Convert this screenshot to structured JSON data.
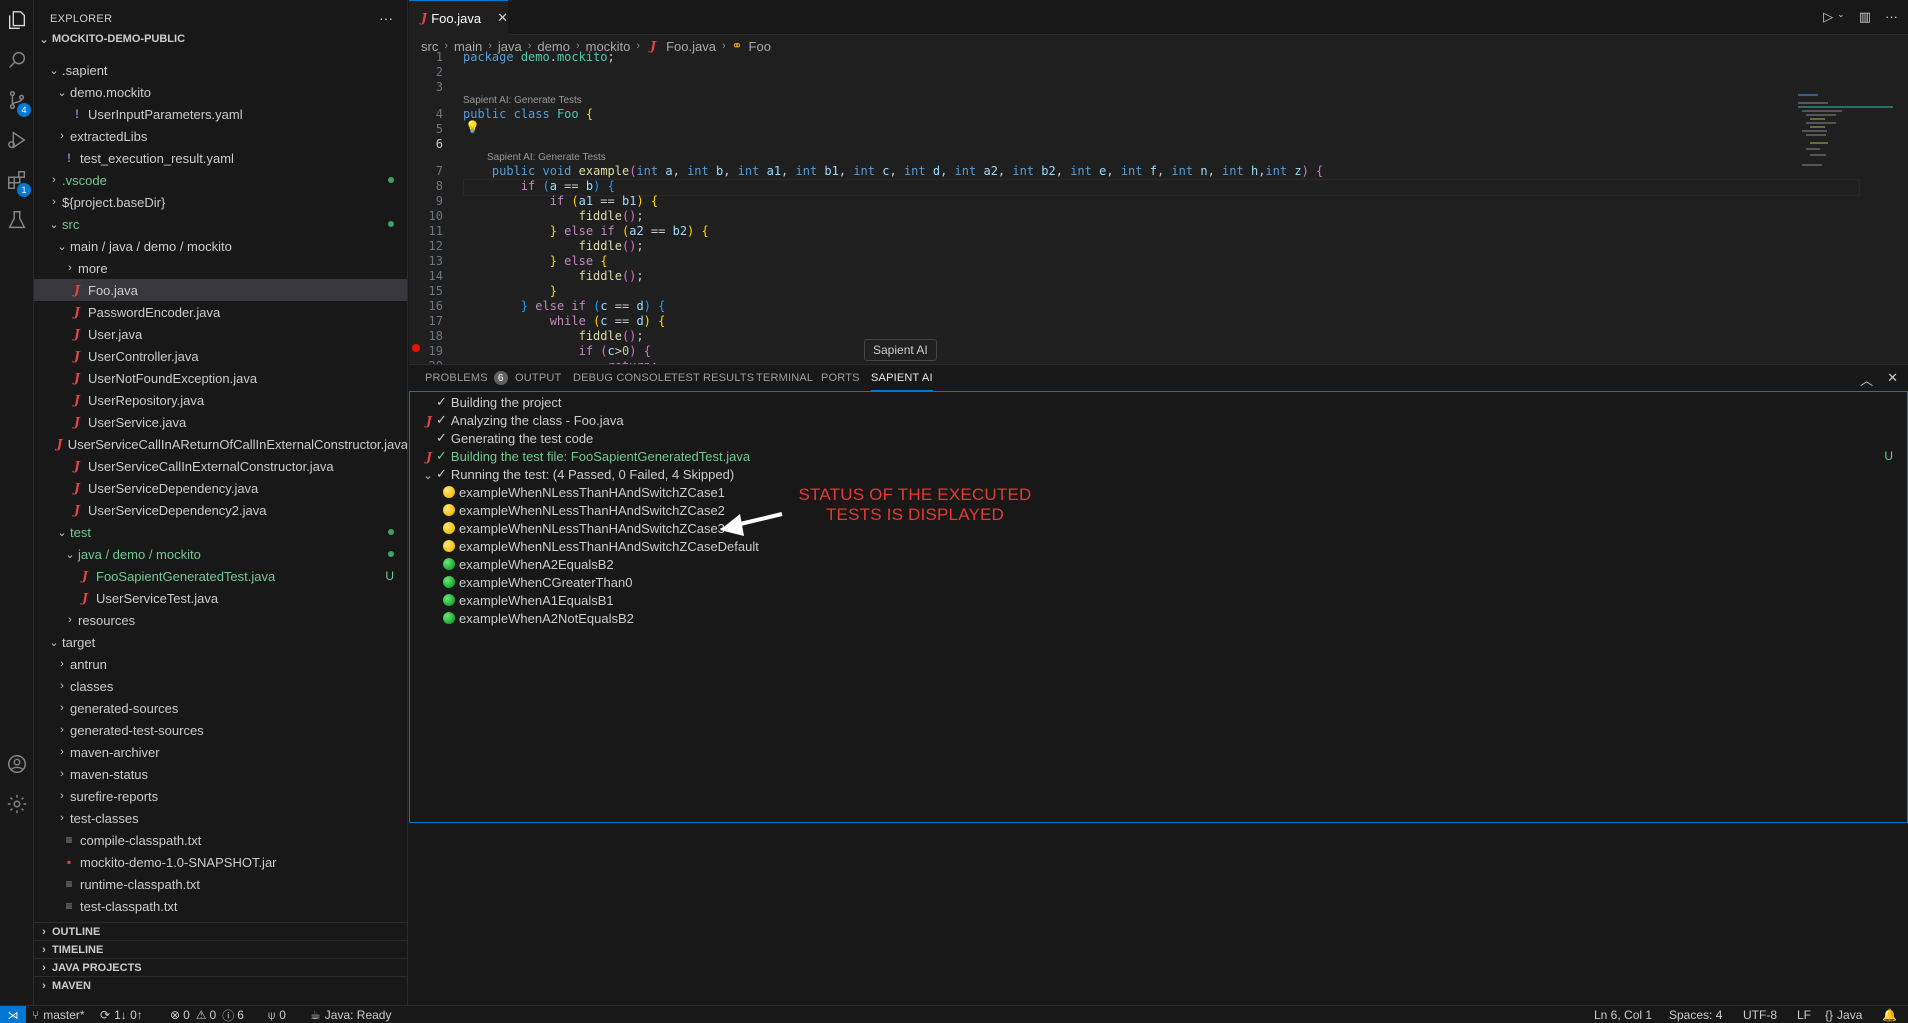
{
  "activity_bar": {
    "source_control_badge": "4",
    "extensions_badge": "1"
  },
  "explorer": {
    "title": "EXPLORER",
    "more": "···",
    "root": "MOCKITO-DEMO-PUBLIC",
    "items": [
      {
        "label": ".sapient",
        "indent": 1,
        "chev": "open"
      },
      {
        "label": "demo.mockito",
        "indent": 2,
        "chev": "open"
      },
      {
        "label": "UserInputParameters.yaml",
        "indent": 3,
        "icon": "yaml"
      },
      {
        "label": "extractedLibs",
        "indent": 2,
        "chev": "closed"
      },
      {
        "label": "test_execution_result.yaml",
        "indent": 2,
        "icon": "yaml"
      },
      {
        "label": ".vscode",
        "indent": 1,
        "chev": "closed",
        "color": "green",
        "dot": true
      },
      {
        "label": "${project.baseDir}",
        "indent": 1,
        "chev": "closed"
      },
      {
        "label": "src",
        "indent": 1,
        "chev": "open",
        "color": "green",
        "dot": true
      },
      {
        "label": "main / java / demo / mockito",
        "indent": 2,
        "chev": "open"
      },
      {
        "label": "more",
        "indent": 3,
        "chev": "closed"
      },
      {
        "label": "Foo.java",
        "indent": 3,
        "icon": "java",
        "selected": true
      },
      {
        "label": "PasswordEncoder.java",
        "indent": 3,
        "icon": "java"
      },
      {
        "label": "User.java",
        "indent": 3,
        "icon": "java"
      },
      {
        "label": "UserController.java",
        "indent": 3,
        "icon": "java"
      },
      {
        "label": "UserNotFoundException.java",
        "indent": 3,
        "icon": "java"
      },
      {
        "label": "UserRepository.java",
        "indent": 3,
        "icon": "java"
      },
      {
        "label": "UserService.java",
        "indent": 3,
        "icon": "java"
      },
      {
        "label": "UserServiceCallInAReturnOfCallInExternalConstructor.java",
        "indent": 3,
        "icon": "java"
      },
      {
        "label": "UserServiceCallInExternalConstructor.java",
        "indent": 3,
        "icon": "java"
      },
      {
        "label": "UserServiceDependency.java",
        "indent": 3,
        "icon": "java"
      },
      {
        "label": "UserServiceDependency2.java",
        "indent": 3,
        "icon": "java"
      },
      {
        "label": "test",
        "indent": 2,
        "chev": "open",
        "color": "green",
        "dot": true
      },
      {
        "label": "java / demo / mockito",
        "indent": 3,
        "chev": "open",
        "color": "green",
        "dot": true
      },
      {
        "label": "FooSapientGeneratedTest.java",
        "indent": 4,
        "icon": "java",
        "color": "green",
        "u": "U"
      },
      {
        "label": "UserServiceTest.java",
        "indent": 4,
        "icon": "java"
      },
      {
        "label": "resources",
        "indent": 3,
        "chev": "closed"
      },
      {
        "label": "target",
        "indent": 1,
        "chev": "open"
      },
      {
        "label": "antrun",
        "indent": 2,
        "chev": "closed"
      },
      {
        "label": "classes",
        "indent": 2,
        "chev": "closed"
      },
      {
        "label": "generated-sources",
        "indent": 2,
        "chev": "closed"
      },
      {
        "label": "generated-test-sources",
        "indent": 2,
        "chev": "closed"
      },
      {
        "label": "maven-archiver",
        "indent": 2,
        "chev": "closed"
      },
      {
        "label": "maven-status",
        "indent": 2,
        "chev": "closed"
      },
      {
        "label": "surefire-reports",
        "indent": 2,
        "chev": "closed"
      },
      {
        "label": "test-classes",
        "indent": 2,
        "chev": "closed"
      },
      {
        "label": "compile-classpath.txt",
        "indent": 2,
        "icon": "txt"
      },
      {
        "label": "mockito-demo-1.0-SNAPSHOT.jar",
        "indent": 2,
        "icon": "jar"
      },
      {
        "label": "runtime-classpath.txt",
        "indent": 2,
        "icon": "txt"
      },
      {
        "label": "test-classpath.txt",
        "indent": 2,
        "icon": "txt"
      }
    ],
    "sections": [
      "OUTLINE",
      "TIMELINE",
      "JAVA PROJECTS",
      "MAVEN"
    ]
  },
  "editor": {
    "tab_label": "Foo.java",
    "tab_close": "✕",
    "breadcrumb": [
      "src",
      "main",
      "java",
      "demo",
      "mockito",
      "Foo.java",
      "Foo"
    ],
    "code_lens": "Sapient AI: Generate Tests",
    "tooltip": "Sapient AI"
  },
  "panel": {
    "tabs": [
      "PROBLEMS",
      "OUTPUT",
      "DEBUG CONSOLE",
      "TEST RESULTS",
      "TERMINAL",
      "PORTS",
      "SAPIENT AI"
    ],
    "problems_count": "6",
    "steps": [
      "Building the project",
      "Analyzing the class - Foo.java",
      "Generating the test code",
      "Building the test file: FooSapientGeneratedTest.java",
      "Running the test: (4 Passed, 0 Failed, 4 Skipped)"
    ],
    "step_u": "U",
    "tests": [
      {
        "name": "exampleWhenNLessThanHAndSwitchZCase1",
        "status": "skipped"
      },
      {
        "name": "exampleWhenNLessThanHAndSwitchZCase2",
        "status": "skipped"
      },
      {
        "name": "exampleWhenNLessThanHAndSwitchZCase3",
        "status": "skipped"
      },
      {
        "name": "exampleWhenNLessThanHAndSwitchZCaseDefault",
        "status": "skipped"
      },
      {
        "name": "exampleWhenA2EqualsB2",
        "status": "passed"
      },
      {
        "name": "exampleWhenCGreaterThan0",
        "status": "passed"
      },
      {
        "name": "exampleWhenA1EqualsB1",
        "status": "passed"
      },
      {
        "name": "exampleWhenA2NotEqualsB2",
        "status": "passed"
      }
    ],
    "annotation_line1": "STATUS OF THE EXECUTED",
    "annotation_line2": "TESTS IS DISPLAYED"
  },
  "statusbar": {
    "branch": "master*",
    "sync": "1↓ 0↑",
    "errors": "0",
    "warnings": "0",
    "infos": "6",
    "ports": "0",
    "java": "Java: Ready",
    "position": "Ln 6, Col 1",
    "spaces": "Spaces: 4",
    "encoding": "UTF-8",
    "eol": "LF",
    "language": "Java"
  },
  "colors": {
    "accent": "#0078d4",
    "added": "#73c991",
    "annotation": "#e53935",
    "skipped": "#f5c518",
    "passed": "#20b33a"
  }
}
